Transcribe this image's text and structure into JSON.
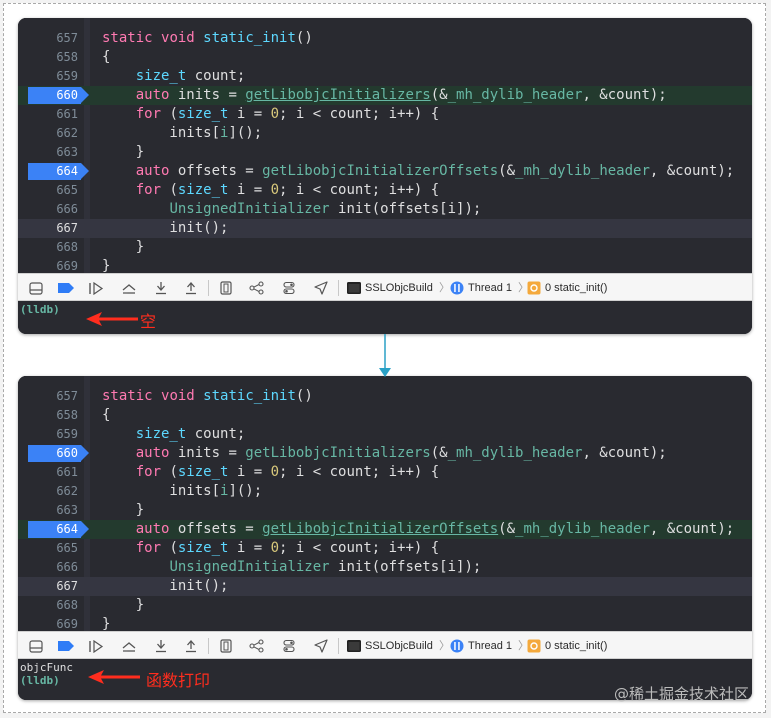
{
  "panels": [
    {
      "code_lines": [
        {
          "n": "657",
          "html": "<span class='kw'>static</span> <span class='kw'>void</span> <span class='ty'>static_init</span>()"
        },
        {
          "n": "658",
          "html": "{"
        },
        {
          "n": "659",
          "html": "    <span class='ty'>size_t</span> count;"
        },
        {
          "n": "660",
          "html": "    <span class='kw'>auto</span> inits = <span class='lnk'>getLibobjcInitializers</span>(&amp;<span class='fn'>_mh_dylib_header</span>, &amp;count);",
          "bp": true,
          "hl": true
        },
        {
          "n": "661",
          "html": "    <span class='kw'>for</span> (<span class='ty'>size_t</span> i = <span class='num'>0</span>; i &lt; count; i++) {"
        },
        {
          "n": "662",
          "html": "        inits[<span class='fn'>i</span>]();"
        },
        {
          "n": "663",
          "html": "    }"
        },
        {
          "n": "664",
          "html": "    <span class='kw'>auto</span> offsets = <span class='fn'>getLibobjcInitializerOffsets</span>(&amp;<span class='fn'>_mh_dylib_header</span>, &amp;count);",
          "bp": true
        },
        {
          "n": "665",
          "html": "    <span class='kw'>for</span> (<span class='ty'>size_t</span> i = <span class='num'>0</span>; i &lt; count; i++) {"
        },
        {
          "n": "666",
          "html": "        <span class='fn'>UnsignedInitializer</span> init(offsets[i]);"
        },
        {
          "n": "667",
          "html": "        init();",
          "current": true
        },
        {
          "n": "668",
          "html": "    }"
        },
        {
          "n": "669",
          "html": "}"
        }
      ],
      "console": [
        {
          "text": "(lldb)",
          "kind": "prompt"
        }
      ],
      "annotation": "空"
    },
    {
      "code_lines": [
        {
          "n": "657",
          "html": "<span class='kw'>static</span> <span class='kw'>void</span> <span class='ty'>static_init</span>()"
        },
        {
          "n": "658",
          "html": "{"
        },
        {
          "n": "659",
          "html": "    <span class='ty'>size_t</span> count;"
        },
        {
          "n": "660",
          "html": "    <span class='kw'>auto</span> inits = <span class='fn'>getLibobjcInitializers</span>(&amp;<span class='fn'>_mh_dylib_header</span>, &amp;count);",
          "bp": true
        },
        {
          "n": "661",
          "html": "    <span class='kw'>for</span> (<span class='ty'>size_t</span> i = <span class='num'>0</span>; i &lt; count; i++) {"
        },
        {
          "n": "662",
          "html": "        inits[<span class='fn'>i</span>]();"
        },
        {
          "n": "663",
          "html": "    }"
        },
        {
          "n": "664",
          "html": "    <span class='kw'>auto</span> offsets = <span class='lnk'>getLibobjcInitializerOffsets</span>(&amp;<span class='fn'>_mh_dylib_header</span>, &amp;count);",
          "bp": true,
          "hl": true
        },
        {
          "n": "665",
          "html": "    <span class='kw'>for</span> (<span class='ty'>size_t</span> i = <span class='num'>0</span>; i &lt; count; i++) {"
        },
        {
          "n": "666",
          "html": "        <span class='fn'>UnsignedInitializer</span> init(offsets[i]);"
        },
        {
          "n": "667",
          "html": "        init();",
          "current": true
        },
        {
          "n": "668",
          "html": "    }"
        },
        {
          "n": "669",
          "html": "}"
        }
      ],
      "console": [
        {
          "text": "objcFunc",
          "kind": "out"
        },
        {
          "text": "(lldb)",
          "kind": "prompt"
        }
      ],
      "annotation": "函数打印"
    }
  ],
  "breadcrumb": {
    "target": "SSLObjcBuild",
    "thread": "Thread 1",
    "frame": "0 static_init()"
  },
  "toolbar_icons": [
    "console-toggle-icon",
    "breakpoints-active-icon",
    "continue-icon",
    "step-over-icon",
    "step-into-icon",
    "step-out-icon",
    "view-hierarchy-icon",
    "memory-graph-icon",
    "environment-overrides-icon",
    "simulate-location-icon"
  ],
  "colors": {
    "editor_bg": "#292a30",
    "keyword": "#ff7ab2",
    "type": "#5dd8ff",
    "function": "#67b7a4",
    "breakpoint": "#3b82f6",
    "annotation": "#ff2d1e",
    "connector_arrow": "#2aa1c6"
  },
  "watermark": "@稀土掘金技术社区"
}
